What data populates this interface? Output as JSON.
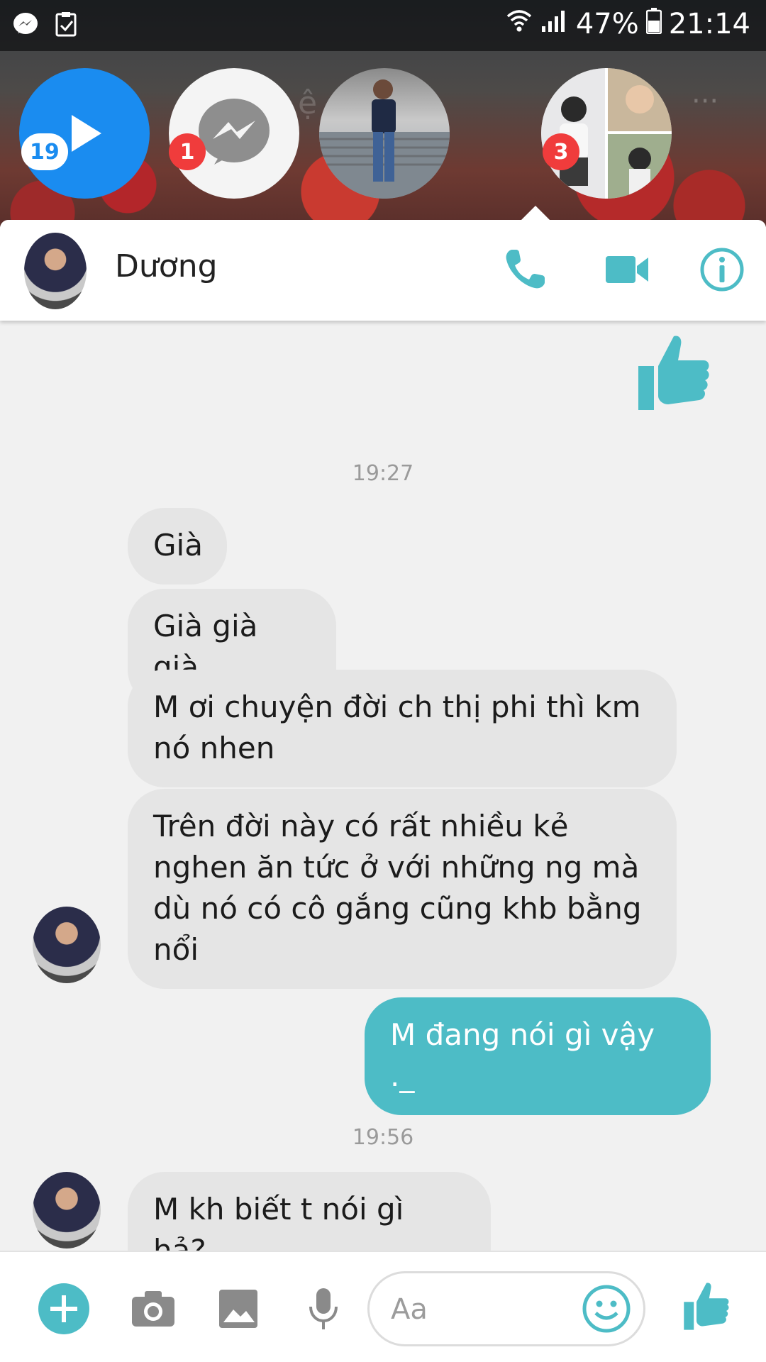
{
  "status_bar": {
    "battery": "47%",
    "time": "21:14"
  },
  "chat_heads": {
    "play_badge": "19",
    "messenger_badge": "1",
    "group_badge": "3"
  },
  "header": {
    "contact_name": "Dương"
  },
  "messages": [
    {
      "type": "timestamp",
      "text": "19:27"
    },
    {
      "type": "incoming",
      "text": "Già"
    },
    {
      "type": "incoming",
      "text": "Già già già"
    },
    {
      "type": "incoming",
      "text": "M ơi chuyện đời ch thị phi thì km nó nhen"
    },
    {
      "type": "incoming",
      "text": "Trên đời này có rất nhiều kẻ nghen ăn tức ở với những ng mà dù nó có cô gắng cũng khb bằng nổi"
    },
    {
      "type": "outgoing",
      "text": "M đang nói gì vậy ._"
    },
    {
      "type": "timestamp",
      "text": "19:56"
    },
    {
      "type": "incoming",
      "text": "M kh biết t nói gì hả?"
    }
  ],
  "composer": {
    "placeholder": "Aa"
  },
  "colors": {
    "accent": "#4dbcc6",
    "messenger_blue": "#1a8cf0",
    "badge_red": "#f03c3c",
    "incoming_bubble": "#e5e5e5"
  }
}
